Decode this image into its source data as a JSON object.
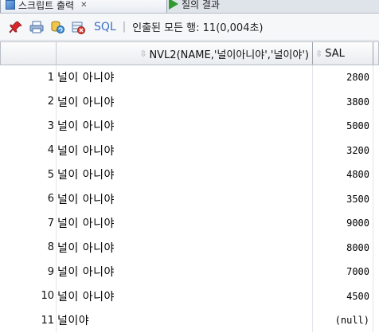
{
  "tabs": [
    {
      "label": "스크립트 출력",
      "active": true,
      "icon": "document-icon"
    },
    {
      "label": "질의 결과",
      "active": false,
      "icon": "play-icon"
    }
  ],
  "toolbar": {
    "sql_label": "SQL",
    "separator": "|",
    "status": "인출된 모든 행: 11(0,004초)"
  },
  "columns": [
    {
      "label": ""
    },
    {
      "label": "NVL2(NAME,'널이아니야','널이야')"
    },
    {
      "label": "SAL"
    }
  ],
  "rows": [
    {
      "num": "1",
      "name": "널이 아니야",
      "sal": "2800"
    },
    {
      "num": "2",
      "name": "널이 아니야",
      "sal": "3800"
    },
    {
      "num": "3",
      "name": "널이 아니야",
      "sal": "5000"
    },
    {
      "num": "4",
      "name": "널이 아니야",
      "sal": "3200"
    },
    {
      "num": "5",
      "name": "널이 아니야",
      "sal": "4800"
    },
    {
      "num": "6",
      "name": "널이 아니야",
      "sal": "3500"
    },
    {
      "num": "7",
      "name": "널이 아니야",
      "sal": "9000"
    },
    {
      "num": "8",
      "name": "널이 아니야",
      "sal": "8000"
    },
    {
      "num": "9",
      "name": "널이 아니야",
      "sal": "7000"
    },
    {
      "num": "10",
      "name": "널이 아니야",
      "sal": "4500"
    },
    {
      "num": "11",
      "name": "널이야",
      "sal": "(null)"
    }
  ]
}
